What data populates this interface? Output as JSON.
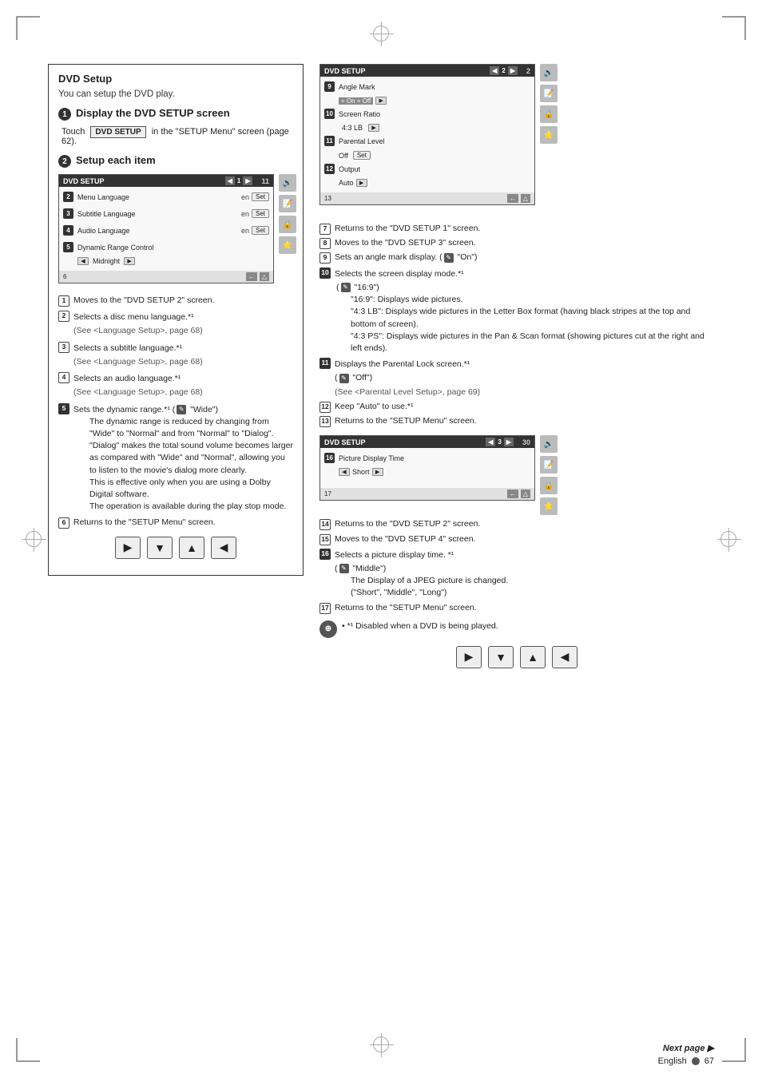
{
  "page": {
    "title": "DVD Setup",
    "subtitle": "You can setup the DVD play.",
    "footer": {
      "next_page": "Next page ▶",
      "language": "English",
      "page_number": "67"
    }
  },
  "step1": {
    "num": "1",
    "title": "Display the DVD SETUP screen",
    "instruction": "Touch",
    "button_label": "DVD SETUP",
    "instruction2": "in the \"SETUP Menu\" screen (page 62)."
  },
  "step2": {
    "num": "2",
    "title": "Setup each item"
  },
  "screen1": {
    "header_title": "DVD SETUP",
    "page_num": "1",
    "total": "11",
    "rows": [
      {
        "num": "2",
        "label": "Menu Language",
        "value": "en",
        "has_set": true
      },
      {
        "num": "3",
        "label": "Subtitle Language",
        "value": "en",
        "has_set": true
      },
      {
        "num": "4",
        "label": "Audio Language",
        "value": "en",
        "has_set": true
      },
      {
        "num": "5",
        "label": "Dynamic Range Control",
        "value": "Midnight",
        "has_ctrl": true
      }
    ],
    "footer_num": "6"
  },
  "left_list": [
    {
      "num": "1",
      "text": "Moves to the \"DVD SETUP 2\" screen."
    },
    {
      "num": "2",
      "text": "Selects a disc menu language.*¹",
      "sub": "(See <Language Setup>, page 68)"
    },
    {
      "num": "3",
      "text": "Selects a subtitle language.*¹",
      "sub": "(See <Language Setup>, page 68)"
    },
    {
      "num": "4",
      "text": "Selects an audio language.*¹",
      "sub": "(See <Language Setup>, page 68)"
    },
    {
      "num": "5",
      "text": "Sets the dynamic range.*¹ (✎ \"Wide\")",
      "details": [
        "The dynamic range is reduced by changing from \"Wide\" to \"Normal\" and from \"Normal\" to \"Dialog\". \"Dialog\" makes the total sound volume becomes larger as compared with \"Wide\" and \"Normal\", allowing you to listen to the movie's dialog more clearly.",
        "This is effective only when you are using a Dolby Digital software.",
        "The operation is available during the play stop mode."
      ]
    },
    {
      "num": "6",
      "text": "Returns to the \"SETUP Menu\" screen."
    }
  ],
  "screen2": {
    "header_title": "DVD SETUP",
    "page_num": "2",
    "total": "2",
    "rows": [
      {
        "num": "9",
        "label": "Angle Mark",
        "value": "",
        "has_onoff": true
      },
      {
        "num": "10",
        "label": "Screen Ratio",
        "value": "4:3 LB",
        "has_ctrl": true
      },
      {
        "num": "11",
        "label": "Parental Level",
        "value": "Off",
        "has_set": true
      },
      {
        "num": "12",
        "label": "Output",
        "value": "Auto",
        "has_ctrl": true
      }
    ],
    "footer_nav": "13"
  },
  "right_list_top": [
    {
      "num": "7",
      "text": "Returns to the \"DVD SETUP 1\" screen."
    },
    {
      "num": "8",
      "text": "Moves to the \"DVD SETUP 3\" screen."
    },
    {
      "num": "9",
      "text": "Sets an angle mark display. (✎ \"On\")"
    },
    {
      "num": "10",
      "text": "Selects the screen display mode.*¹",
      "sub": "(✎ \"16:9\")",
      "details": [
        "\"16:9\":    Displays wide pictures.",
        "\"4:3 LB\":  Displays wide pictures in the Letter Box format (having black stripes at the top and bottom of screen).",
        "\"4:3 PS\":  Displays wide pictures in the Pan & Scan format (showing pictures cut at the right and left ends)."
      ]
    },
    {
      "num": "11",
      "text": "Displays the Parental Lock screen.*¹",
      "sub": "(✎ \"Off\")",
      "sub2": "(See <Parental Level Setup>, page 69)"
    },
    {
      "num": "12",
      "text": "Keep \"Auto\" to use.*¹"
    },
    {
      "num": "13",
      "text": "Returns to the \"SETUP Menu\" screen."
    }
  ],
  "screen3": {
    "header_title": "DVD SETUP",
    "page_num": "3",
    "total": "30",
    "rows": [
      {
        "num": "16",
        "label": "Picture Display Time",
        "value": "Short",
        "has_ctrl": true
      }
    ],
    "footer_nav": "17"
  },
  "right_list_bottom": [
    {
      "num": "14",
      "text": "Returns to the \"DVD SETUP 2\" screen."
    },
    {
      "num": "15",
      "text": "Moves to the \"DVD SETUP 4\" screen."
    },
    {
      "num": "16",
      "text": "Selects a picture display time. *¹",
      "sub": "(✎ \"Middle\")",
      "details": [
        "The Display of a JPEG picture is changed.",
        "(\"Short\", \"Middle\", \"Long\")"
      ]
    },
    {
      "num": "17",
      "text": "Returns to the \"SETUP Menu\" screen."
    }
  ],
  "note": {
    "symbol": "⊕",
    "text": "• *¹ Disabled when a DVD is being played."
  },
  "nav_buttons": {
    "prev": "◀",
    "down": "▼",
    "up": "▲",
    "next_right": "◀"
  }
}
